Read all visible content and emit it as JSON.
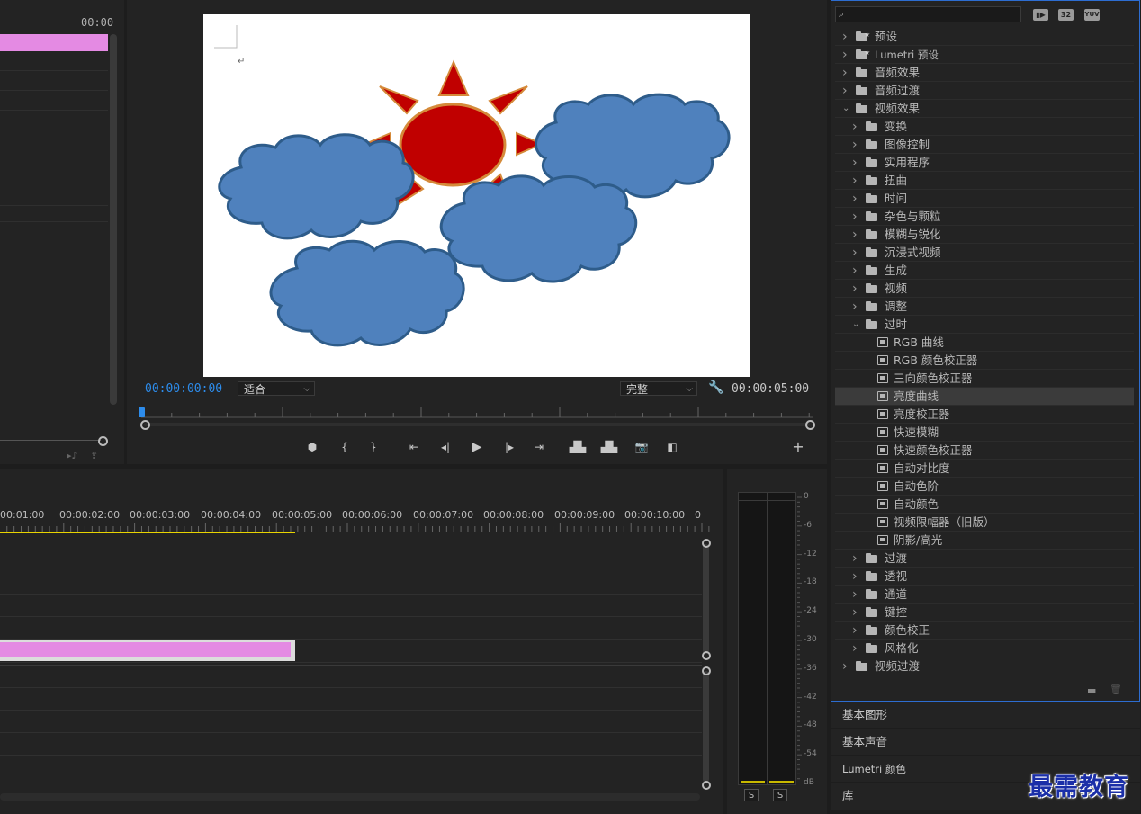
{
  "source": {
    "timecode": "00:00"
  },
  "program": {
    "timecode_current": "00:00:00:00",
    "timecode_duration": "00:00:05:00",
    "fit_select": "适合",
    "quality_select": "完整"
  },
  "timeline": {
    "ruler_labels": [
      "00:01:00",
      "00:00:02:00",
      "00:00:03:00",
      "00:00:04:00",
      "00:00:05:00",
      "00:00:06:00",
      "00:00:07:00",
      "00:00:08:00",
      "00:00:09:00",
      "00:00:10:00",
      "0"
    ]
  },
  "meter": {
    "db_labels": [
      "0",
      "-6",
      "-12",
      "-18",
      "-24",
      "-30",
      "-36",
      "-42",
      "-48",
      "-54",
      "dB"
    ],
    "solo_left": "S",
    "solo_right": "S"
  },
  "effects": {
    "search_placeholder": "",
    "badge_32": "32",
    "badge_yuv": "YUV",
    "items": [
      {
        "label": "预设",
        "level": 0,
        "type": "folder-star",
        "open": false
      },
      {
        "label": "Lumetri 预设",
        "level": 0,
        "type": "folder-star",
        "open": false
      },
      {
        "label": "音频效果",
        "level": 0,
        "type": "folder",
        "open": false
      },
      {
        "label": "音频过渡",
        "level": 0,
        "type": "folder",
        "open": false
      },
      {
        "label": "视频效果",
        "level": 0,
        "type": "folder",
        "open": true
      },
      {
        "label": "变换",
        "level": 1,
        "type": "folder",
        "open": false
      },
      {
        "label": "图像控制",
        "level": 1,
        "type": "folder",
        "open": false
      },
      {
        "label": "实用程序",
        "level": 1,
        "type": "folder",
        "open": false
      },
      {
        "label": "扭曲",
        "level": 1,
        "type": "folder",
        "open": false
      },
      {
        "label": "时间",
        "level": 1,
        "type": "folder",
        "open": false
      },
      {
        "label": "杂色与颗粒",
        "level": 1,
        "type": "folder",
        "open": false
      },
      {
        "label": "模糊与锐化",
        "level": 1,
        "type": "folder",
        "open": false
      },
      {
        "label": "沉浸式视频",
        "level": 1,
        "type": "folder",
        "open": false
      },
      {
        "label": "生成",
        "level": 1,
        "type": "folder",
        "open": false
      },
      {
        "label": "视频",
        "level": 1,
        "type": "folder",
        "open": false
      },
      {
        "label": "调整",
        "level": 1,
        "type": "folder",
        "open": false
      },
      {
        "label": "过时",
        "level": 1,
        "type": "folder",
        "open": true
      },
      {
        "label": "RGB 曲线",
        "level": 2,
        "type": "fx"
      },
      {
        "label": "RGB 颜色校正器",
        "level": 2,
        "type": "fx"
      },
      {
        "label": "三向颜色校正器",
        "level": 2,
        "type": "fx"
      },
      {
        "label": "亮度曲线",
        "level": 2,
        "type": "fx",
        "selected": true
      },
      {
        "label": "亮度校正器",
        "level": 2,
        "type": "fx"
      },
      {
        "label": "快速模糊",
        "level": 2,
        "type": "fx"
      },
      {
        "label": "快速颜色校正器",
        "level": 2,
        "type": "fx"
      },
      {
        "label": "自动对比度",
        "level": 2,
        "type": "fx"
      },
      {
        "label": "自动色阶",
        "level": 2,
        "type": "fx"
      },
      {
        "label": "自动颜色",
        "level": 2,
        "type": "fx"
      },
      {
        "label": "视频限幅器（旧版）",
        "level": 2,
        "type": "fx"
      },
      {
        "label": "阴影/高光",
        "level": 2,
        "type": "fx"
      },
      {
        "label": "过渡",
        "level": 1,
        "type": "folder",
        "open": false
      },
      {
        "label": "透视",
        "level": 1,
        "type": "folder",
        "open": false
      },
      {
        "label": "通道",
        "level": 1,
        "type": "folder",
        "open": false
      },
      {
        "label": "键控",
        "level": 1,
        "type": "folder",
        "open": false
      },
      {
        "label": "颜色校正",
        "level": 1,
        "type": "folder",
        "open": false
      },
      {
        "label": "风格化",
        "level": 1,
        "type": "folder",
        "open": false
      },
      {
        "label": "视频过渡",
        "level": 0,
        "type": "folder",
        "open": false
      }
    ]
  },
  "panels": {
    "essential_graphics": "基本图形",
    "essential_sound": "基本声音",
    "lumetri_color": "Lumetri 颜色",
    "library": "库"
  },
  "watermark": "最需教育",
  "colors": {
    "clip": "#e48ae3",
    "accent_blue": "#2d8ceb",
    "playhead_yellow": "#e8d400"
  }
}
